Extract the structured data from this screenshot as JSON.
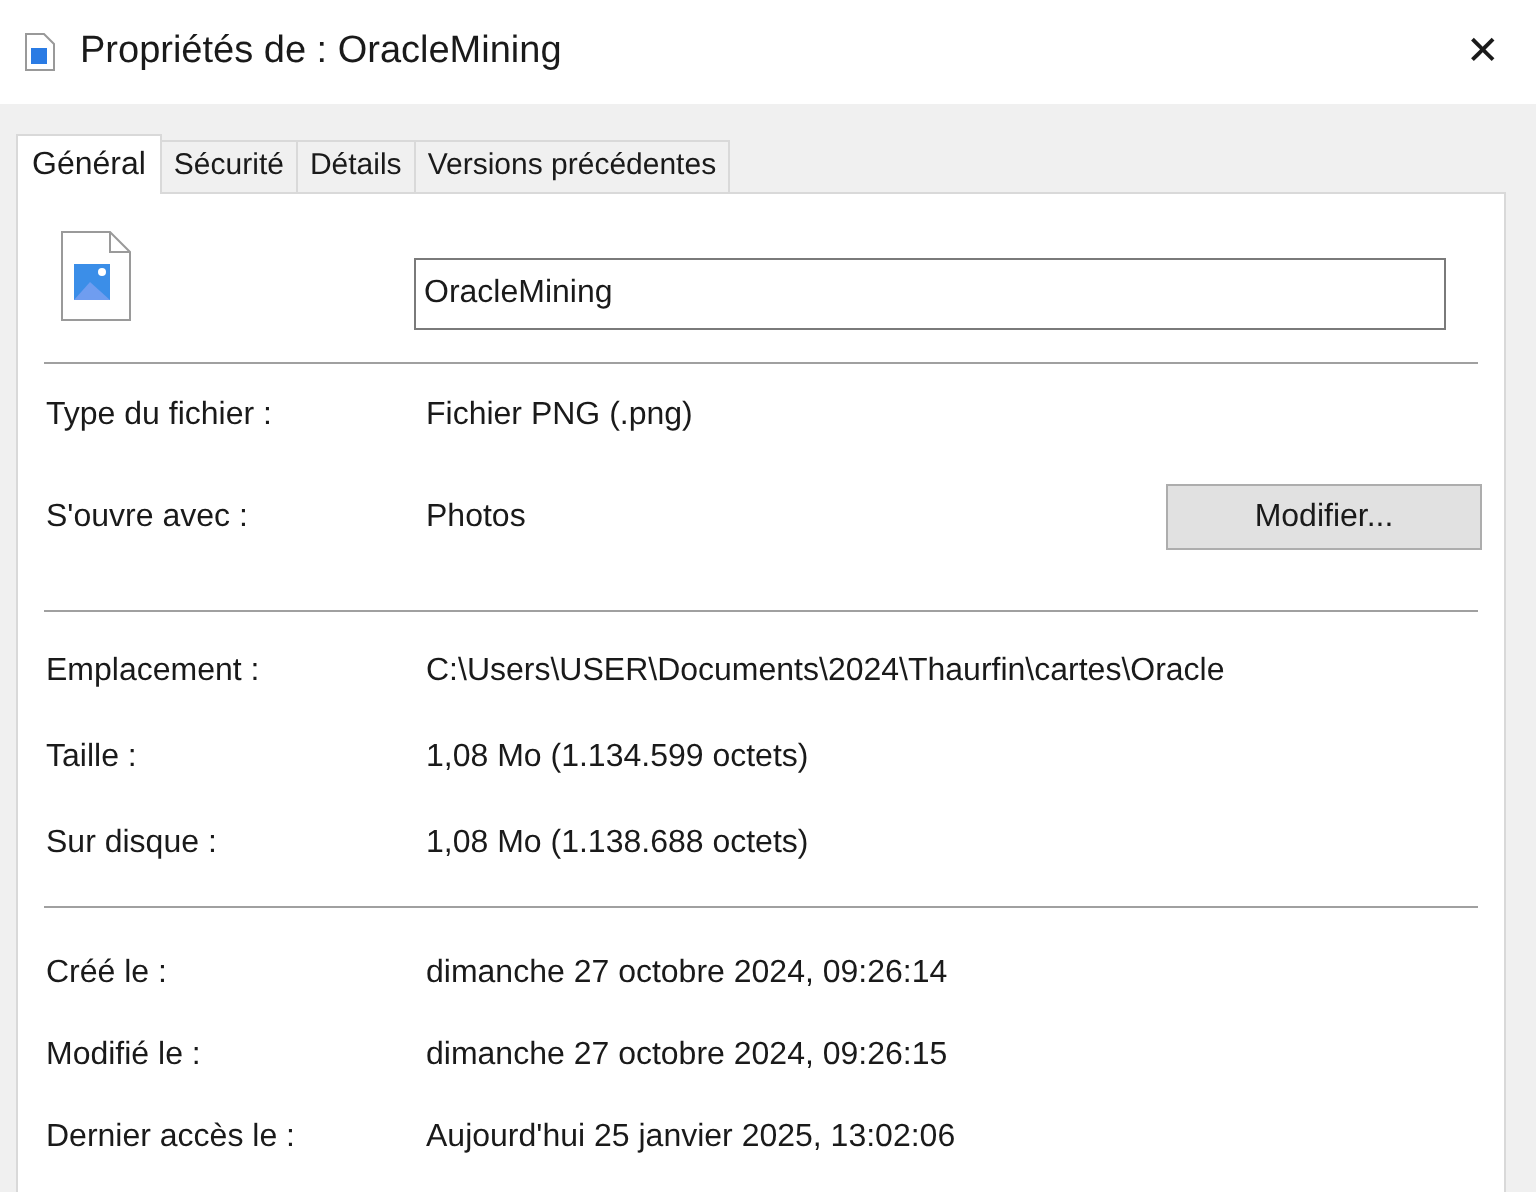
{
  "window": {
    "title": "Propriétés de : OracleMining",
    "close": "✕"
  },
  "tabs": [
    {
      "label": "Général",
      "selected": true
    },
    {
      "label": "Sécurité",
      "selected": false
    },
    {
      "label": "Détails",
      "selected": false
    },
    {
      "label": "Versions précédentes",
      "selected": false
    }
  ],
  "file_name": "OracleMining",
  "sections": [
    [
      {
        "label": "Type du fichier :",
        "value": "Fichier PNG (.png)"
      },
      {
        "label": "S'ouvre avec :",
        "value": "Photos",
        "button": "Modifier..."
      }
    ],
    [
      {
        "label": "Emplacement :",
        "value": "C:\\Users\\USER\\Documents\\2024\\Thaurfin\\cartes\\Oracle"
      },
      {
        "label": "Taille :",
        "value": "1,08 Mo (1.134.599 octets)"
      },
      {
        "label": "Sur disque :",
        "value": "1,08 Mo (1.138.688 octets)"
      }
    ],
    [
      {
        "label": "Créé le :",
        "value": "dimanche 27 octobre 2024, 09:26:14"
      },
      {
        "label": "Modifié le :",
        "value": "dimanche 27 octobre 2024, 09:26:15"
      },
      {
        "label": "Dernier accès le :",
        "value": "Aujourd'hui 25 janvier 2025, 13:02:06"
      }
    ]
  ]
}
